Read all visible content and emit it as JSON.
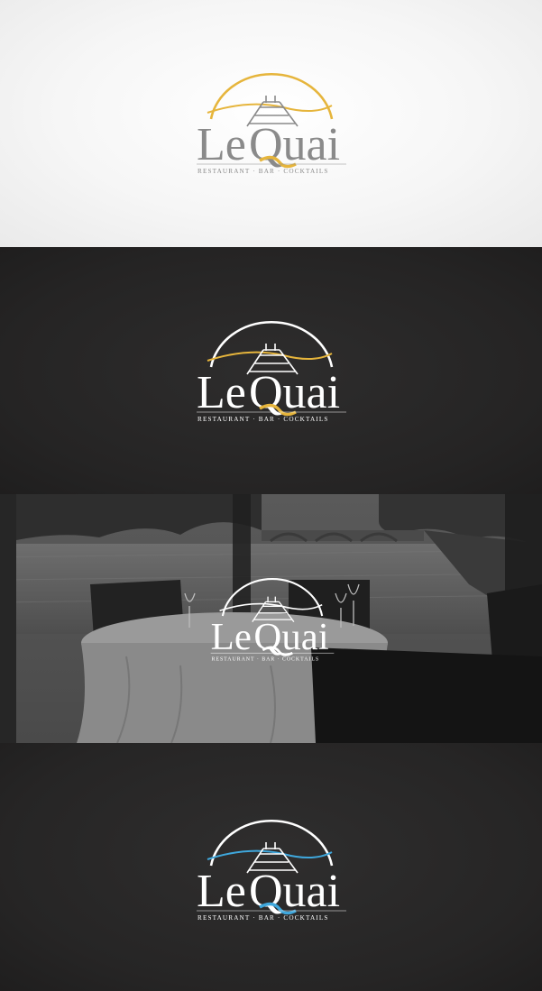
{
  "brand": {
    "word_le": "Le",
    "word_quai": "Quai",
    "tagline": "RESTAURANT · BAR · COCKTAILS"
  },
  "variants": [
    {
      "background": "light",
      "text_color": "#8a8a8a",
      "arc_color": "#e6b53c",
      "accent_color": "#e6b53c"
    },
    {
      "background": "dark",
      "text_color": "#ffffff",
      "arc_color": "#ffffff",
      "accent_color": "#e6b53c"
    },
    {
      "background": "photo",
      "text_color": "#ffffff",
      "arc_color": "#ffffff",
      "accent_color": "#ffffff"
    },
    {
      "background": "dark",
      "text_color": "#ffffff",
      "arc_color": "#ffffff",
      "accent_color": "#3fa7dc"
    }
  ],
  "colors": {
    "gold": "#e6b53c",
    "blue": "#3fa7dc",
    "gray": "#8a8a8a",
    "dark_bg": "#252424",
    "light_bg": "#f6f6f6"
  }
}
